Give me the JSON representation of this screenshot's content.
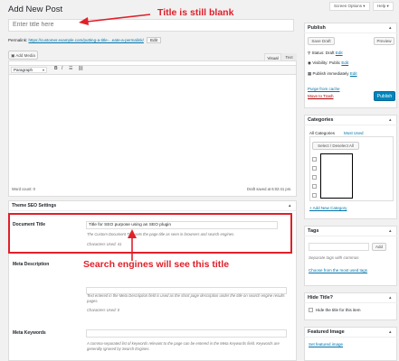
{
  "header": {
    "page_title": "Add New Post",
    "screen_options": "Screen Options ▾",
    "help": "Help ▾"
  },
  "title_field": {
    "placeholder": "Enter title here"
  },
  "permalink": {
    "label": "Permalink:",
    "url": "https://customer.example.com/putting-a-title-...eate-a-permalink/",
    "edit": "Edit"
  },
  "editor": {
    "add_media": "Add Media",
    "tab_visual": "Visual",
    "tab_text": "Text",
    "format_select": "Paragraph",
    "word_count": "Word count: 0",
    "draft_saved": "Draft saved at 6:02:41 pm."
  },
  "annotations": {
    "title_note": "Title is still blank",
    "search_note": "Search engines will see this title",
    "colors": {
      "annotation_red": "#e0202a",
      "link_blue": "#0073aa",
      "primary_blue": "#0085ba"
    }
  },
  "seo": {
    "heading": "Theme SEO Settings",
    "doc_title_label": "Document Title",
    "doc_title_value": "Title for SEO purpose using an SEO plugin",
    "doc_title_desc": "The Custom Document Title sets the page title as seen in browsers and search engines.",
    "doc_title_count": "Characters Used: 41",
    "meta_desc_label": "Meta Description",
    "meta_desc_desc": "Text entered in the Meta Description field is used as the short page description under the title on search engine results pages.",
    "meta_desc_count": "Characters Used: 0",
    "meta_kw_label": "Meta Keywords",
    "meta_kw_desc": "A comma-separated list of keywords relevant to the page can be entered in the Meta Keywords field. Keywords are generally ignored by Search Engines."
  },
  "publish": {
    "heading": "Publish",
    "save_draft": "Save Draft",
    "preview": "Preview",
    "status": "Status: Draft",
    "visibility": "Visibility: Public",
    "schedule": "Publish immediately",
    "edit": "Edit",
    "purge": "Purge from cache",
    "trash": "Move to Trash",
    "publish_btn": "Publish"
  },
  "categories": {
    "heading": "Categories",
    "tab_all": "All Categories",
    "tab_most": "Most Used",
    "select_all": "Select / Deselect All",
    "add_new": "+ Add New Category"
  },
  "tags": {
    "heading": "Tags",
    "add": "Add",
    "hint": "Separate tags with commas",
    "choose": "Choose from the most used tags"
  },
  "hide_title": {
    "heading": "Hide Title?",
    "checkbox_label": "Hide the title for this item"
  },
  "featured": {
    "heading": "Featured Image",
    "set_link": "Set featured image"
  }
}
